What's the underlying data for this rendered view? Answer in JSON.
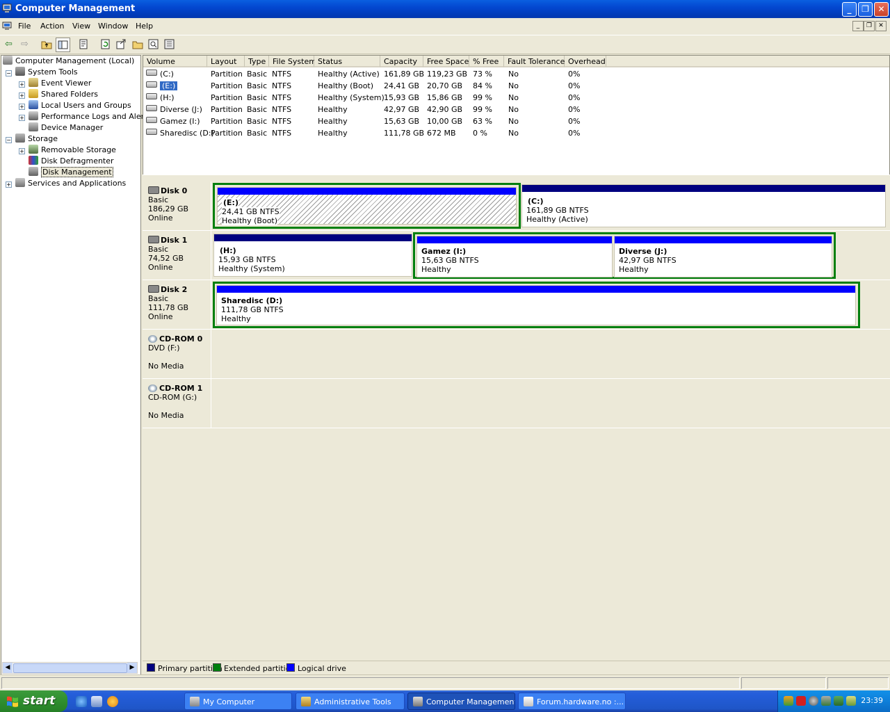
{
  "window": {
    "title": "Computer Management"
  },
  "menu": {
    "items": [
      "File",
      "Action",
      "View",
      "Window",
      "Help"
    ]
  },
  "tree": {
    "root": "Computer Management (Local)",
    "system_tools": "System Tools",
    "event_viewer": "Event Viewer",
    "shared_folders": "Shared Folders",
    "local_users": "Local Users and Groups",
    "perf_logs": "Performance Logs and Alerts",
    "device_manager": "Device Manager",
    "storage": "Storage",
    "removable_storage": "Removable Storage",
    "disk_defrag": "Disk Defragmenter",
    "disk_mgmt": "Disk Management",
    "services": "Services and Applications"
  },
  "volumes": {
    "columns": [
      "Volume",
      "Layout",
      "Type",
      "File System",
      "Status",
      "Capacity",
      "Free Space",
      "% Free",
      "Fault Tolerance",
      "Overhead"
    ],
    "rows": [
      [
        "(C:)",
        "Partition",
        "Basic",
        "NTFS",
        "Healthy (Active)",
        "161,89 GB",
        "119,23 GB",
        "73 %",
        "No",
        "0%"
      ],
      [
        "(E:)",
        "Partition",
        "Basic",
        "NTFS",
        "Healthy (Boot)",
        "24,41 GB",
        "20,70 GB",
        "84 %",
        "No",
        "0%"
      ],
      [
        "(H:)",
        "Partition",
        "Basic",
        "NTFS",
        "Healthy (System)",
        "15,93 GB",
        "15,86 GB",
        "99 %",
        "No",
        "0%"
      ],
      [
        "Diverse (J:)",
        "Partition",
        "Basic",
        "NTFS",
        "Healthy",
        "42,97 GB",
        "42,90 GB",
        "99 %",
        "No",
        "0%"
      ],
      [
        "Gamez (I:)",
        "Partition",
        "Basic",
        "NTFS",
        "Healthy",
        "15,63 GB",
        "10,00 GB",
        "63 %",
        "No",
        "0%"
      ],
      [
        "Sharedisc (D:)",
        "Partition",
        "Basic",
        "NTFS",
        "Healthy",
        "111,78 GB",
        "672 MB",
        "0 %",
        "No",
        "0%"
      ]
    ]
  },
  "disks": [
    {
      "name": "Disk 0",
      "type": "Basic",
      "size": "186,29 GB",
      "status": "Online",
      "partitions": [
        {
          "name": "(E:)",
          "size": "24,41 GB NTFS",
          "status": "Healthy (Boot)"
        },
        {
          "name": "(C:)",
          "size": "161,89 GB NTFS",
          "status": "Healthy (Active)"
        }
      ]
    },
    {
      "name": "Disk 1",
      "type": "Basic",
      "size": "74,52 GB",
      "status": "Online",
      "partitions": [
        {
          "name": "(H:)",
          "size": "15,93 GB NTFS",
          "status": "Healthy (System)"
        },
        {
          "name": "Gamez  (I:)",
          "size": "15,63 GB NTFS",
          "status": "Healthy"
        },
        {
          "name": "Diverse  (J:)",
          "size": "42,97 GB NTFS",
          "status": "Healthy"
        }
      ]
    },
    {
      "name": "Disk 2",
      "type": "Basic",
      "size": "111,78 GB",
      "status": "Online",
      "partitions": [
        {
          "name": "Sharedisc  (D:)",
          "size": "111,78 GB NTFS",
          "status": "Healthy"
        }
      ]
    },
    {
      "name": "CD-ROM 0",
      "type": "DVD (F:)",
      "status": "No Media"
    },
    {
      "name": "CD-ROM 1",
      "type": "CD-ROM (G:)",
      "status": "No Media"
    }
  ],
  "legend": {
    "primary": "Primary partition",
    "extended": "Extended partition",
    "logical": "Logical drive"
  },
  "colors": {
    "primary": "#00007f",
    "extended": "#007f0e",
    "logical": "#0000ff",
    "selection": "#316ac5"
  },
  "taskbar": {
    "start": "start",
    "tasks": [
      "My Computer",
      "Administrative Tools",
      "Computer Management",
      "Forum.hardware.no :..."
    ],
    "clock": "23:39"
  },
  "icons": [
    "computer-management-icon",
    "back-arrow-icon",
    "forward-arrow-icon",
    "up-folder-icon",
    "show-tree-icon",
    "properties-icon",
    "refresh-icon",
    "export-icon",
    "open-icon",
    "search-icon",
    "help-icon"
  ]
}
